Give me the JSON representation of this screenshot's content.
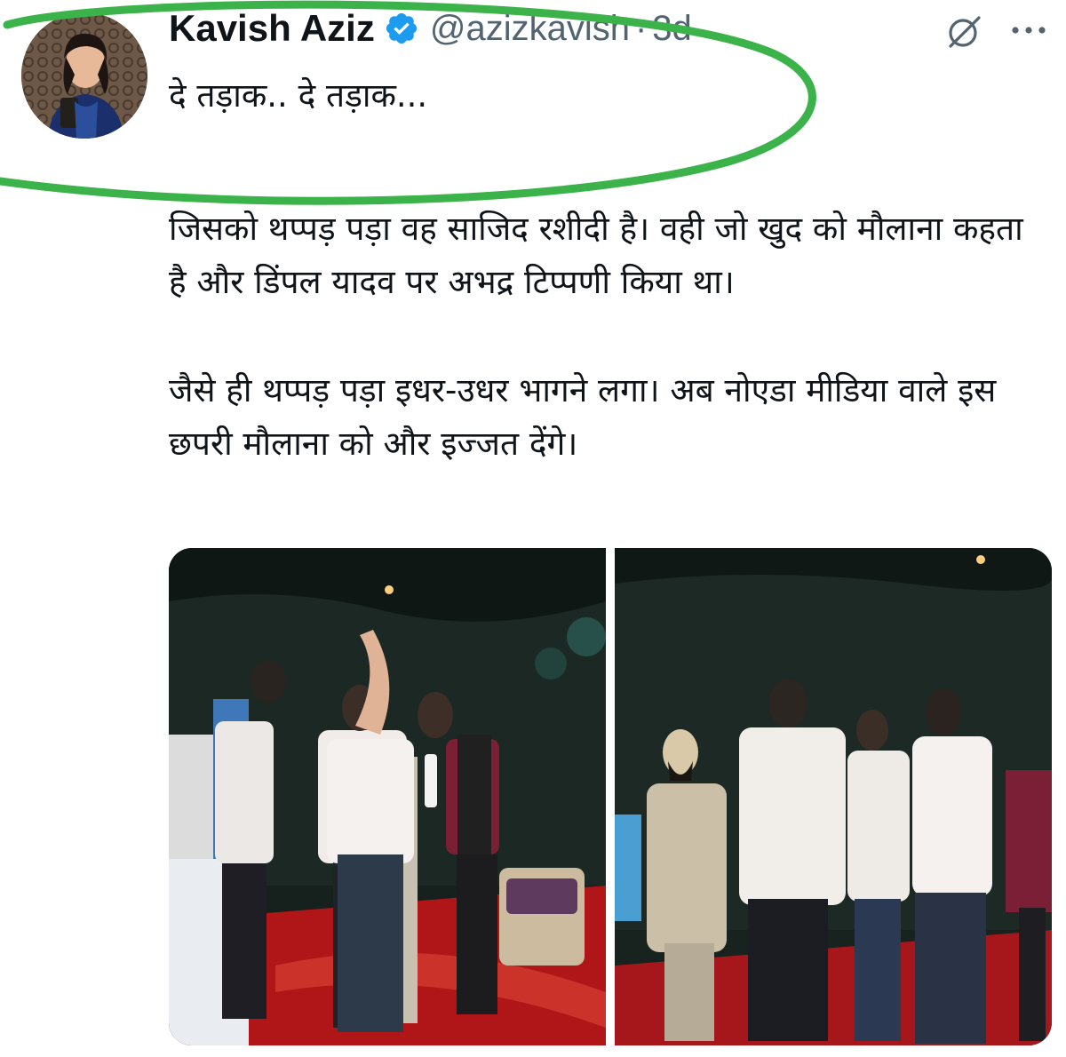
{
  "tweet": {
    "author_name": "Kavish Aziz",
    "handle": "@azizkavish",
    "separator": "·",
    "time": "3d",
    "lines": {
      "line1": "दे तड़ाक.. दे तड़ाक...",
      "para2": "जिसको थप्पड़ पड़ा वह साजिद रशीदी है। वही जो खुद को मौलाना कहता है और डिंपल यादव पर अभद्र टिप्पणी किया था।",
      "para3": "जैसे ही थप्पड़ पड़ा इधर-उधर भागने लगा। अब नोएडा मीडिया वाले इस छपरी मौलाना को और इज्जत देंगे।"
    },
    "icons": {
      "verified": "verified-badge-icon",
      "grok": "grok-icon",
      "more": "more-options-icon"
    },
    "media_count": 2
  },
  "colors": {
    "verified_blue": "#1d9bf0",
    "secondary_text": "#536471",
    "annotation_green": "#3cb34a",
    "stage_red": "#c4161c"
  }
}
